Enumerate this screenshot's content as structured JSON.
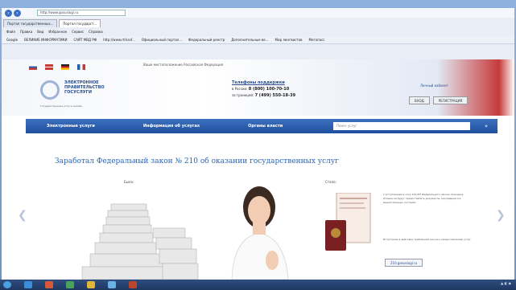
{
  "browser": {
    "address": "http://www.gosuslugi.ru",
    "tabs": [
      "Портал государственных...",
      "Портал государст..."
    ],
    "menu": [
      "Файл",
      "Правка",
      "Вид",
      "Избранное",
      "Сервис",
      "Справка"
    ],
    "favorites": [
      "Google",
      "ВЕЛИКИЕ ИНФОРМАТИКИ",
      "САЙТ МВД РФ",
      "http://www.rtrksof...",
      "Официальный портал...",
      "Федеральный реестр",
      "Дополнительные ве...",
      "Мир лингвистов",
      "Мегапасс"
    ]
  },
  "site": {
    "extra_tabs": "Ваше местоположение   Российская Федерация",
    "logo_text": "ЭЛЕКТРОННОЕ ПРАВИТЕЛЬСТВО ГОСУСЛУГИ",
    "logo_sub": "Государственные услуги онлайн",
    "phone_title": "Телефоны поддержки",
    "phone_ru_label": "в России:",
    "phone_ru": "8 (800) 100-70-10",
    "phone_abroad_label": "за границей:",
    "phone_abroad": "7 (499) 550-18-39",
    "auth_title": "Личный кабинет",
    "login_btn": "ВХОД",
    "register_btn": "РЕГИСТРАЦИЯ",
    "nav": [
      "Электронные услуги",
      "Информация об услугах",
      "Органы власти"
    ],
    "search_placeholder": "Поиск услуг",
    "headline": "Заработал Федеральный закон № 210 об оказании государственных услуг",
    "label_before": "Было:",
    "label_after": "Стало:",
    "desc1": "С вступлением в силу 210-ФЗ Федерального закона граждане больше не будут предоставлять документы, находящиеся в ведомственных системах.",
    "desc2": "Вступление в действие требований закона к предоставлению услуг",
    "gos_link": "210.gosuslugi.ru"
  },
  "colors": {
    "brand_blue": "#2a5ea8",
    "accent_red": "#c63a3a",
    "headline_blue": "#2b67b8"
  }
}
